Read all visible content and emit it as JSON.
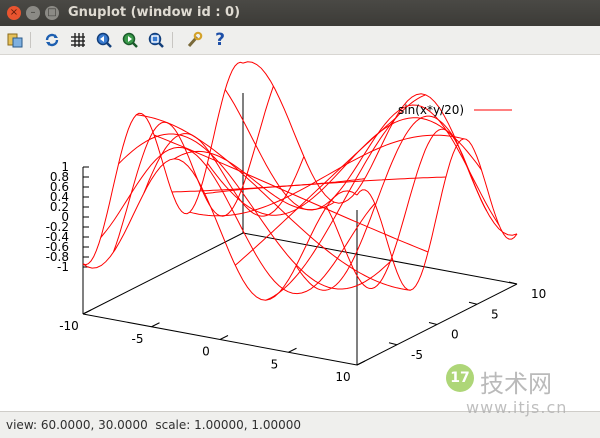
{
  "window": {
    "title": "Gnuplot (window id : 0)",
    "close_glyph": "×",
    "min_glyph": "–",
    "max_glyph": "□"
  },
  "toolbar": {
    "items": [
      {
        "name": "copy-to-clipboard-icon"
      },
      {
        "name": "replot-icon"
      },
      {
        "name": "grid-icon"
      },
      {
        "name": "zoom-previous-icon"
      },
      {
        "name": "zoom-next-icon"
      },
      {
        "name": "unzoom-icon"
      },
      {
        "name": "preferences-icon"
      },
      {
        "name": "help-icon"
      }
    ],
    "help_glyph": "?"
  },
  "status": {
    "text": "view: 60.0000, 30.0000  scale: 1.00000, 1.00000"
  },
  "watermark": {
    "logo": "17",
    "name": "技术网",
    "url": "www.itjs.cn"
  },
  "colors": {
    "curve": "#ff0000",
    "axis": "#000000"
  },
  "chart_data": {
    "type": "surface",
    "function": "sin(x*y/20)",
    "legend": "sin(x*y/20)",
    "legend_position": "top-right",
    "x_range": [
      -10,
      10
    ],
    "y_range": [
      -10,
      10
    ],
    "z_range": [
      -1,
      1
    ],
    "samples": 10,
    "view": [
      60,
      30
    ],
    "x_ticks": [
      "-10",
      "-5",
      "0",
      "5",
      "10"
    ],
    "y_ticks": [
      "-5",
      "0",
      "5",
      "10"
    ],
    "z_ticks": [
      "1",
      "0.8",
      "0.6",
      "0.4",
      "0.2",
      "0",
      "-0.2",
      "-0.4",
      "-0.6",
      "-0.8",
      "-1"
    ]
  }
}
